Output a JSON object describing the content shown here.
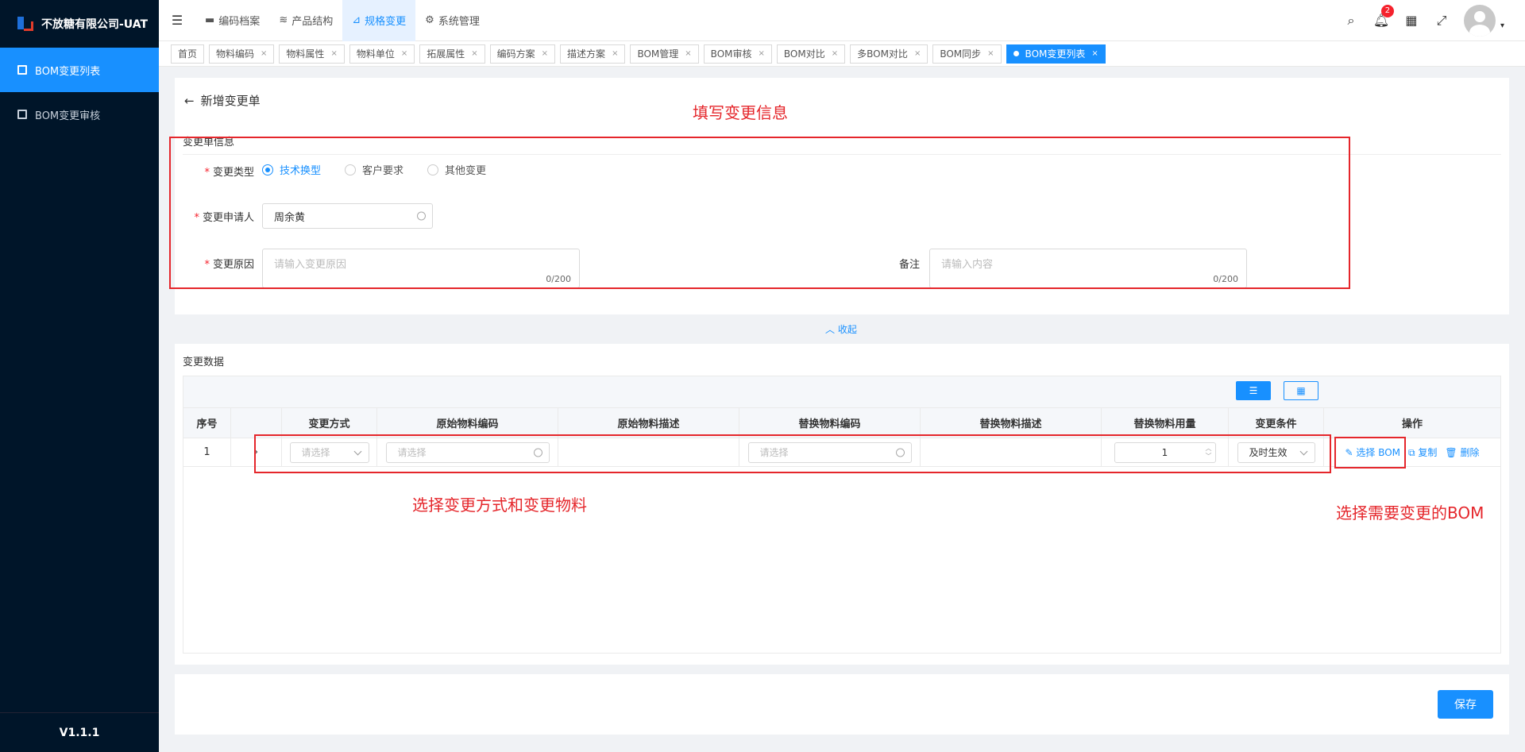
{
  "sidebar": {
    "logo_text": "不放糖有限公司-UAT",
    "items": [
      {
        "label": "BOM变更列表",
        "active": true
      },
      {
        "label": "BOM变更审核",
        "active": false
      }
    ],
    "version": "V1.1.1"
  },
  "topbar": {
    "nav": [
      {
        "label": "编码档案",
        "icon": "folder-icon"
      },
      {
        "label": "产品结构",
        "icon": "layers-icon"
      },
      {
        "label": "规格变更",
        "icon": "flow-icon",
        "active": true
      },
      {
        "label": "系统管理",
        "icon": "gear-icon"
      }
    ],
    "notification_count": "2"
  },
  "tabs": [
    "首页",
    "物料编码",
    "物料属性",
    "物料单位",
    "拓展属性",
    "编码方案",
    "描述方案",
    "BOM管理",
    "BOM审核",
    "BOM对比",
    "多BOM对比",
    "BOM同步",
    "BOM变更列表"
  ],
  "form": {
    "back_title": "新增变更单",
    "section_title": "变更单信息",
    "change_type_label": "变更类型",
    "change_types": [
      "技术换型",
      "客户要求",
      "其他变更"
    ],
    "applicant_label": "变更申请人",
    "applicant_value": "周余黄",
    "reason_label": "变更原因",
    "reason_placeholder": "请输入变更原因",
    "reason_count": "0/200",
    "remark_label": "备注",
    "remark_placeholder": "请输入内容",
    "remark_count": "0/200",
    "collapse_label": "收起"
  },
  "data_section": {
    "title": "变更数据",
    "columns": [
      "序号",
      "",
      "变更方式",
      "原始物料编码",
      "原始物料描述",
      "替换物料编码",
      "替换物料描述",
      "替换物料用量",
      "变更条件",
      "操作"
    ],
    "row": {
      "index": "1",
      "method_placeholder": "请选择",
      "orig_code_placeholder": "请选择",
      "new_code_placeholder": "请选择",
      "quantity": "1",
      "condition": "及时生效",
      "ops": [
        "选择 BOM",
        "复制",
        "删除"
      ]
    }
  },
  "save_label": "保存",
  "annotations": {
    "fill_info": "填写变更信息",
    "select_method": "选择变更方式和变更物料",
    "select_bom": "选择需要变更的BOM"
  },
  "colors": {
    "accent": "#1890ff",
    "sidebar_bg": "#001529",
    "annotation": "#e5262b"
  }
}
